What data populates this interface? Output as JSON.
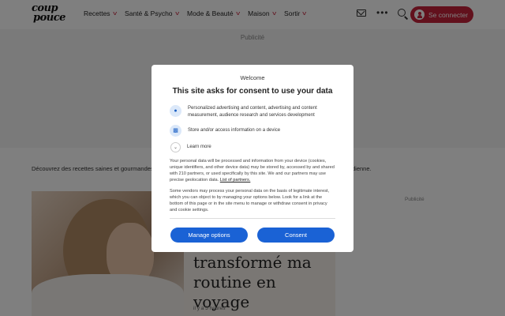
{
  "header": {
    "logo_line1": "coup",
    "logo_line2": "pouce",
    "nav": [
      {
        "label": "Recettes"
      },
      {
        "label": "Santé & Psycho"
      },
      {
        "label": "Mode & Beauté"
      },
      {
        "label": "Maison"
      },
      {
        "label": "Sortir"
      }
    ],
    "login_label": "Se connecter",
    "icons": [
      "mail-icon",
      "more-icon",
      "search-icon",
      "user-icon"
    ]
  },
  "page": {
    "ad_label": "Publicité",
    "intro_text": "Découvrez des recettes saines et gourmandes,",
    "intro_end": "dienne.",
    "article": {
      "title": "transformé ma routine en voyage",
      "time": "il y a 5 heures"
    },
    "side_ad_label": "Publicité"
  },
  "consent": {
    "welcome": "Welcome",
    "title": "This site asks for consent to use your data",
    "purposes": [
      {
        "icon": "person-icon",
        "text": "Personalized advertising and content, advertising and content measurement, audience research and services development"
      },
      {
        "icon": "device-icon",
        "text": "Store and/or access information on a device"
      }
    ],
    "learn_more": "Learn more",
    "paragraph1_main": "Your personal data will be processed and information from your device (cookies, unique identifiers, and other device data) may be stored by, accessed by and shared with 210 partners, or used specifically by this site. We and our partners may use precise geolocation data.",
    "partners_link": "List of partners.",
    "paragraph2": "Some vendors may process your personal data on the basis of legitimate interest, which you can object to by managing your options below. Look for a link at the bottom of this page or in the site menu to manage or withdraw consent in privacy and cookie settings.",
    "manage_label": "Manage options",
    "consent_label": "Consent"
  },
  "colors": {
    "brand_red": "#c4223a",
    "button_blue": "#1a62d5"
  }
}
